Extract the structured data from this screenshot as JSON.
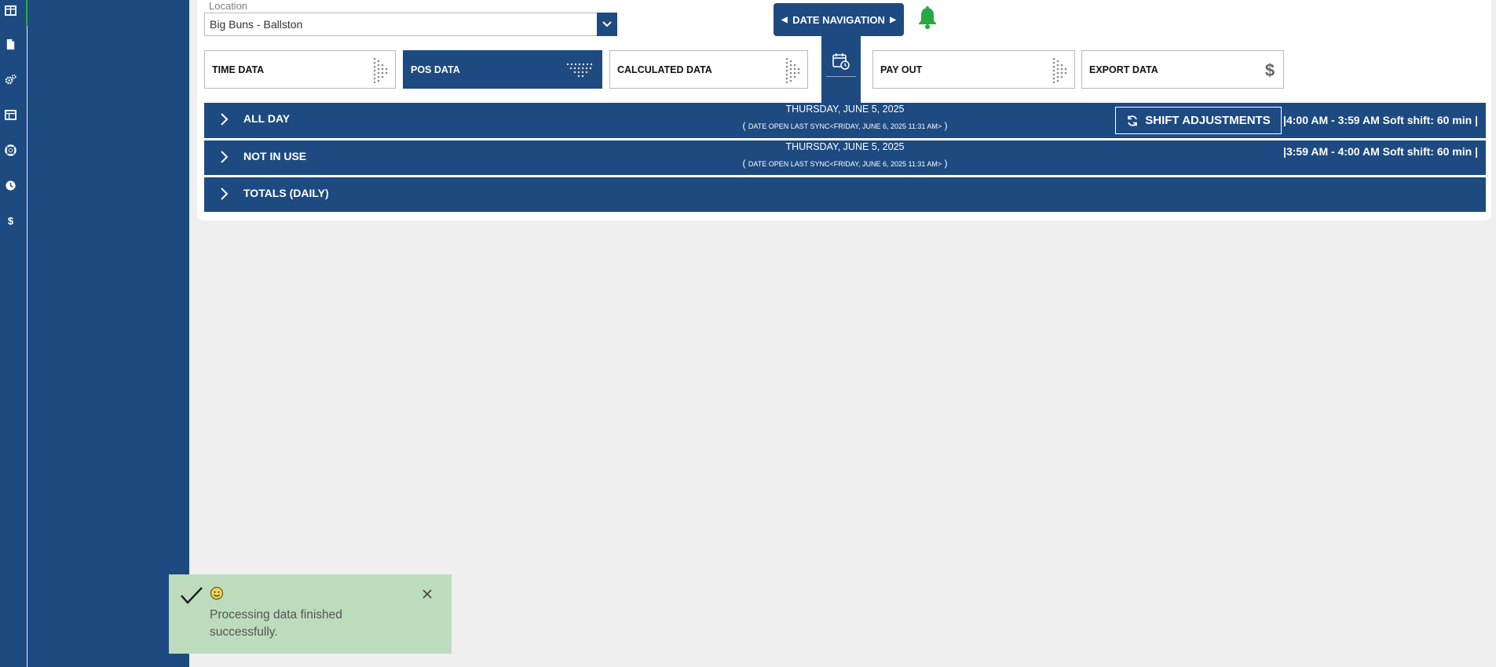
{
  "rail": {
    "icons": [
      "dashboard-icon",
      "document-icon",
      "settings-icon",
      "table-icon",
      "support-icon",
      "clock-icon",
      "dollar-icon"
    ]
  },
  "location": {
    "label": "Location",
    "value": "Big Buns - Ballston"
  },
  "date_navigation": {
    "label": "DATE NAVIGATION"
  },
  "tabs": [
    {
      "label": "TIME DATA",
      "icon": "play-dots-icon",
      "active": false
    },
    {
      "label": "POS DATA",
      "icon": "down-dots-icon",
      "active": true
    },
    {
      "label": "CALCULATED DATA",
      "icon": "play-dots-icon",
      "active": false
    },
    {
      "label": "PAY OUT",
      "icon": "play-dots-icon",
      "active": false
    },
    {
      "label": "EXPORT DATA",
      "icon": "dollar-icon",
      "active": false
    }
  ],
  "rows": [
    {
      "title": "ALL DAY",
      "date": "THURSDAY, JUNE 5, 2025",
      "sync": "DATE OPEN LAST SYNC<FRIDAY, JUNE 6, 2025 11:31 AM>",
      "shift": "|4:00 AM - 3:59 AM Soft shift: 60 min |",
      "button": "SHIFT ADJUSTMENTS"
    },
    {
      "title": "NOT IN USE",
      "date": "THURSDAY, JUNE 5, 2025",
      "sync": "DATE OPEN LAST SYNC<FRIDAY, JUNE 6, 2025 11:31 AM>",
      "shift": "|3:59 AM - 4:00 AM Soft shift: 60 min |"
    },
    {
      "title": "TOTALS (DAILY)"
    }
  ],
  "toast": {
    "message": "Processing data finished successfully."
  },
  "colors": {
    "primary": "#1d4a80",
    "accent_green": "#28a745",
    "toast_bg": "#bddbbd"
  }
}
